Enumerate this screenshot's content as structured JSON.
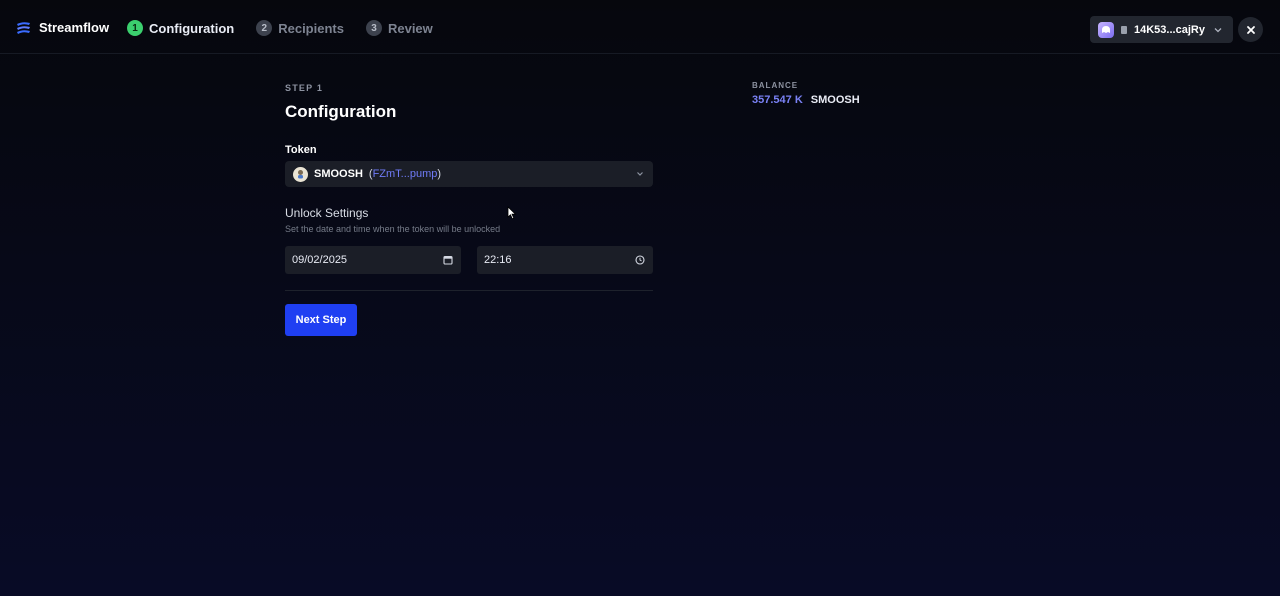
{
  "brand": {
    "name": "Streamflow"
  },
  "steps": [
    {
      "number": "1",
      "label": "Configuration",
      "state": "active"
    },
    {
      "number": "2",
      "label": "Recipients",
      "state": "inactive"
    },
    {
      "number": "3",
      "label": "Review",
      "state": "inactive"
    }
  ],
  "wallet": {
    "address": "14K53...cajRy"
  },
  "main": {
    "step_kicker": "STEP 1",
    "title": "Configuration",
    "token_label": "Token",
    "token": {
      "name": "SMOOSH",
      "address": "FZmT...pump"
    },
    "unlock_title": "Unlock Settings",
    "unlock_subtitle": "Set the date and time when the token will be unlocked",
    "date_value": "09/02/2025",
    "time_value": "22:16",
    "next_button": "Next Step"
  },
  "balance": {
    "label": "BALANCE",
    "amount": "357.547 K",
    "symbol": "SMOOSH"
  },
  "colors": {
    "accent": "#1f3ff2",
    "active_step": "#3bcf6e",
    "link": "#6f7bf7"
  }
}
